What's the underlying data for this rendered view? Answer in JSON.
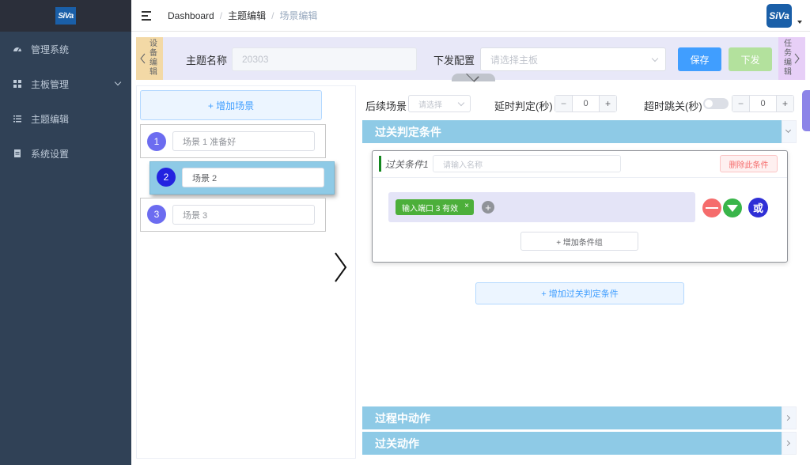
{
  "sidebar": {
    "logo": "SiVa",
    "items": [
      {
        "label": "管理系统",
        "icon": "dashboard-icon"
      },
      {
        "label": "主板管理",
        "icon": "grid-icon"
      },
      {
        "label": "主题编辑",
        "icon": "list-icon"
      },
      {
        "label": "系统设置",
        "icon": "document-icon"
      }
    ]
  },
  "header": {
    "breadcrumb": [
      "Dashboard",
      "主题编辑",
      "场景编辑"
    ],
    "avatar": "SiVa"
  },
  "top_bar": {
    "left_tab": "设备编辑",
    "right_tab": "任务编辑",
    "theme_name_label": "主题名称",
    "theme_name_value": "20303",
    "dispatch_label": "下发配置",
    "dispatch_placeholder": "请选择主板",
    "save_label": "保存",
    "dispatch_button": "下发"
  },
  "scenes": {
    "add_label": "+ 增加场景",
    "items": [
      {
        "num": "1",
        "name": "场景 1 准备好"
      },
      {
        "num": "2",
        "name": "场景 2"
      },
      {
        "num": "3",
        "name": "场景 3"
      }
    ]
  },
  "settings": {
    "next_scene_label": "后续场景",
    "next_scene_placeholder": "请选择",
    "delay_label": "延时判定(秒)",
    "delay_value": "0",
    "timeout_label": "超时跳关(秒)",
    "timeout_value": "0",
    "minus": "−",
    "plus": "+"
  },
  "sections": {
    "pass_conditions": "过关判定条件",
    "in_progress_actions": "过程中动作",
    "pass_actions": "过关动作"
  },
  "condition": {
    "title": "过关条件1",
    "name_placeholder": "请输入名称",
    "delete_label": "删除此条件",
    "tag_label": "输入端口 3 有效",
    "tag_close": "×",
    "add_item": "+",
    "or_label": "或",
    "add_group_label": "+ 增加条件组"
  },
  "add_condition_label": "+ 增加过关判定条件",
  "colors": {
    "sidebar": "#304156",
    "section_header": "#8ecae6",
    "primary": "#409eff",
    "success": "#4caf3a"
  }
}
